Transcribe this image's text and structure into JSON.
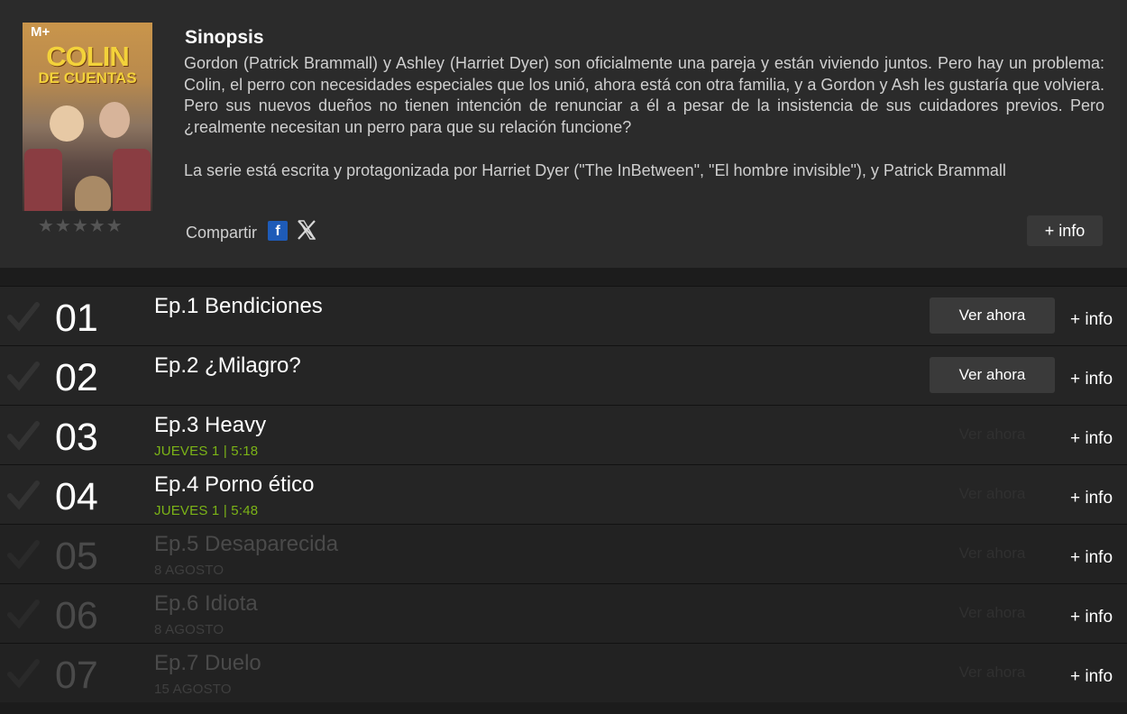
{
  "header": {
    "poster_logo": "M+",
    "poster_title_line1": "COLIN",
    "poster_title_line2": "DE CUENTAS",
    "rating_stars": "★★★★★",
    "rating_value": 0,
    "synopsis_title": "Sinopsis",
    "synopsis_paragraph1": "Gordon (Patrick Brammall) y Ashley (Harriet Dyer) son oficialmente una pareja y están viviendo juntos. Pero hay un problema: Colin, el perro con necesidades especiales que los unió, ahora está con otra familia, y a Gordon y Ash les gustaría que volviera. Pero sus nuevos dueños no tienen intención de renunciar a él a pesar de la insistencia de sus cuidadores previos. Pero ¿realmente necesitan un perro para que su relación funcione?",
    "synopsis_paragraph2": "La serie está escrita y protagonizada por Harriet Dyer (\"The InBetween\", \"El hombre invisible\"), y Patrick Brammall",
    "share_label": "Compartir",
    "facebook_glyph": "f",
    "more_info_label": "+ info"
  },
  "episodes": [
    {
      "num": "01",
      "title": "Ep.1 Bendiciones",
      "date": "",
      "watch_label": "Ver ahora",
      "info_label": "+ info",
      "available": true
    },
    {
      "num": "02",
      "title": "Ep.2 ¿Milagro?",
      "date": "",
      "watch_label": "Ver ahora",
      "info_label": "+ info",
      "available": true
    },
    {
      "num": "03",
      "title": "Ep.3 Heavy",
      "date": "JUEVES 1 | 5:18",
      "watch_label": "Ver ahora",
      "info_label": "+ info",
      "available": false
    },
    {
      "num": "04",
      "title": "Ep.4 Porno ético",
      "date": "JUEVES 1 | 5:48",
      "watch_label": "Ver ahora",
      "info_label": "+ info",
      "available": false
    },
    {
      "num": "05",
      "title": "Ep.5 Desaparecida",
      "date": "8 AGOSTO",
      "watch_label": "Ver ahora",
      "info_label": "+ info",
      "available": false,
      "dim": true
    },
    {
      "num": "06",
      "title": "Ep.6 Idiota",
      "date": "8 AGOSTO",
      "watch_label": "Ver ahora",
      "info_label": "+ info",
      "available": false,
      "dim": true
    },
    {
      "num": "07",
      "title": "Ep.7 Duelo",
      "date": "15 AGOSTO",
      "watch_label": "Ver ahora",
      "info_label": "+ info",
      "available": false,
      "dim": true
    }
  ],
  "colors": {
    "airing_date": "#7bb317",
    "facebook": "#1e5bb8"
  }
}
